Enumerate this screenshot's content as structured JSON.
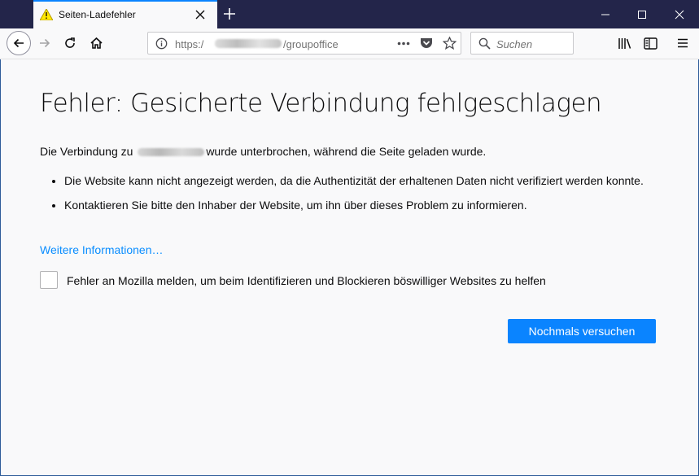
{
  "browser": {
    "tab": {
      "title": "Seiten-Ladefehler",
      "icon": "warning-icon"
    },
    "url": {
      "prefix": "https:/",
      "path": "/groupoffice"
    },
    "search": {
      "placeholder": "Suchen"
    }
  },
  "error": {
    "title": "Fehler: Gesicherte Verbindung fehlgeschlagen",
    "desc_before": "Die Verbindung zu ",
    "desc_after": "wurde unterbrochen, während die Seite geladen wurde.",
    "bullets": [
      "Die Website kann nicht angezeigt werden, da die Authentizität der erhaltenen Daten nicht verifiziert werden konnte.",
      "Kontaktieren Sie bitte den Inhaber der Website, um ihn über dieses Problem zu informieren."
    ],
    "more_info": "Weitere Informationen…",
    "report_label": "Fehler an Mozilla melden, um beim Identifizieren und Blockieren böswilliger Websites zu helfen",
    "retry_label": "Nochmals versuchen"
  },
  "colors": {
    "accent": "#0a84ff",
    "titlebar": "#23254a",
    "link": "#0a8dff"
  }
}
